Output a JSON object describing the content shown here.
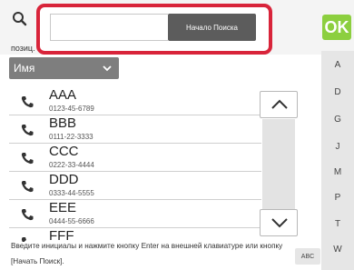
{
  "search": {
    "value": "",
    "start_label": "Начало Поиска"
  },
  "toolbar": {
    "ok_label": "OK"
  },
  "position_label": "позиц.",
  "sort": {
    "selected": "Имя"
  },
  "contacts": [
    {
      "name": "AAA",
      "number": "0123-45-6789"
    },
    {
      "name": "BBB",
      "number": "0111-22-3333"
    },
    {
      "name": "CCC",
      "number": "0222-33-4444"
    },
    {
      "name": "DDD",
      "number": "0333-44-5555"
    },
    {
      "name": "EEE",
      "number": "0444-55-6666"
    },
    {
      "name": "FFF",
      "number": ""
    }
  ],
  "index": [
    "A",
    "D",
    "G",
    "J",
    "M",
    "P",
    "T",
    "W"
  ],
  "hint": "Введите инициалы и нажмите кнопку Enter на внешней клавиатуре или кнопку [Начать Поиск].",
  "abc_label": "ABC",
  "colors": {
    "highlight": "#d8243a",
    "ok": "#8ccf3f",
    "button": "#5c5c5c"
  }
}
